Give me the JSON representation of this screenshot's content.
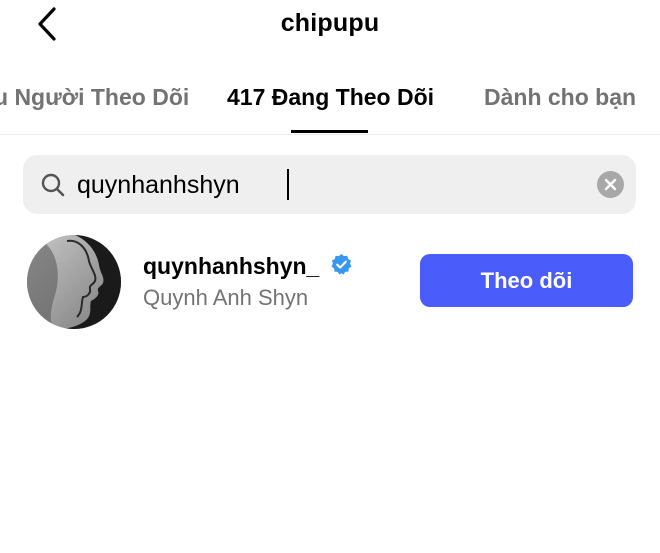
{
  "header": {
    "title": "chipupu",
    "back_icon": "chevron-left-icon"
  },
  "tabs": [
    {
      "label": "u Người Theo Dõi",
      "active": false
    },
    {
      "label": "417 Đang Theo Dõi",
      "active": true
    },
    {
      "label": "Dành cho bạn",
      "active": false
    }
  ],
  "search": {
    "value": "quynhanhshyn",
    "icon": "search-icon",
    "clear_icon": "clear-x-icon"
  },
  "results": [
    {
      "username": "quynhanhshyn_",
      "verified": true,
      "full_name": "Quynh Anh Shyn",
      "button_label": "Theo dõi"
    }
  ],
  "colors": {
    "accent": "#4a5cf9",
    "verified": "#3897f0",
    "secondary_text": "#737373",
    "search_bg": "#efefef"
  }
}
